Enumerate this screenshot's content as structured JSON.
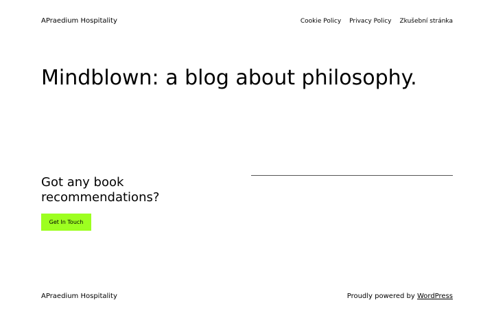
{
  "header": {
    "site_title": "APraedium Hospitality",
    "nav": [
      {
        "label": "Cookie Policy"
      },
      {
        "label": "Privacy Policy"
      },
      {
        "label": "Zkušební stránka"
      }
    ]
  },
  "main": {
    "title": "Mindblown: a blog about philosophy.",
    "cta": {
      "heading": "Got any book recommendations?",
      "button_label": "Get In Touch",
      "button_color": "#9dff20"
    }
  },
  "footer": {
    "site_title": "APraedium Hospitality",
    "credit_prefix": "Proudly powered by ",
    "credit_link": "WordPress"
  }
}
